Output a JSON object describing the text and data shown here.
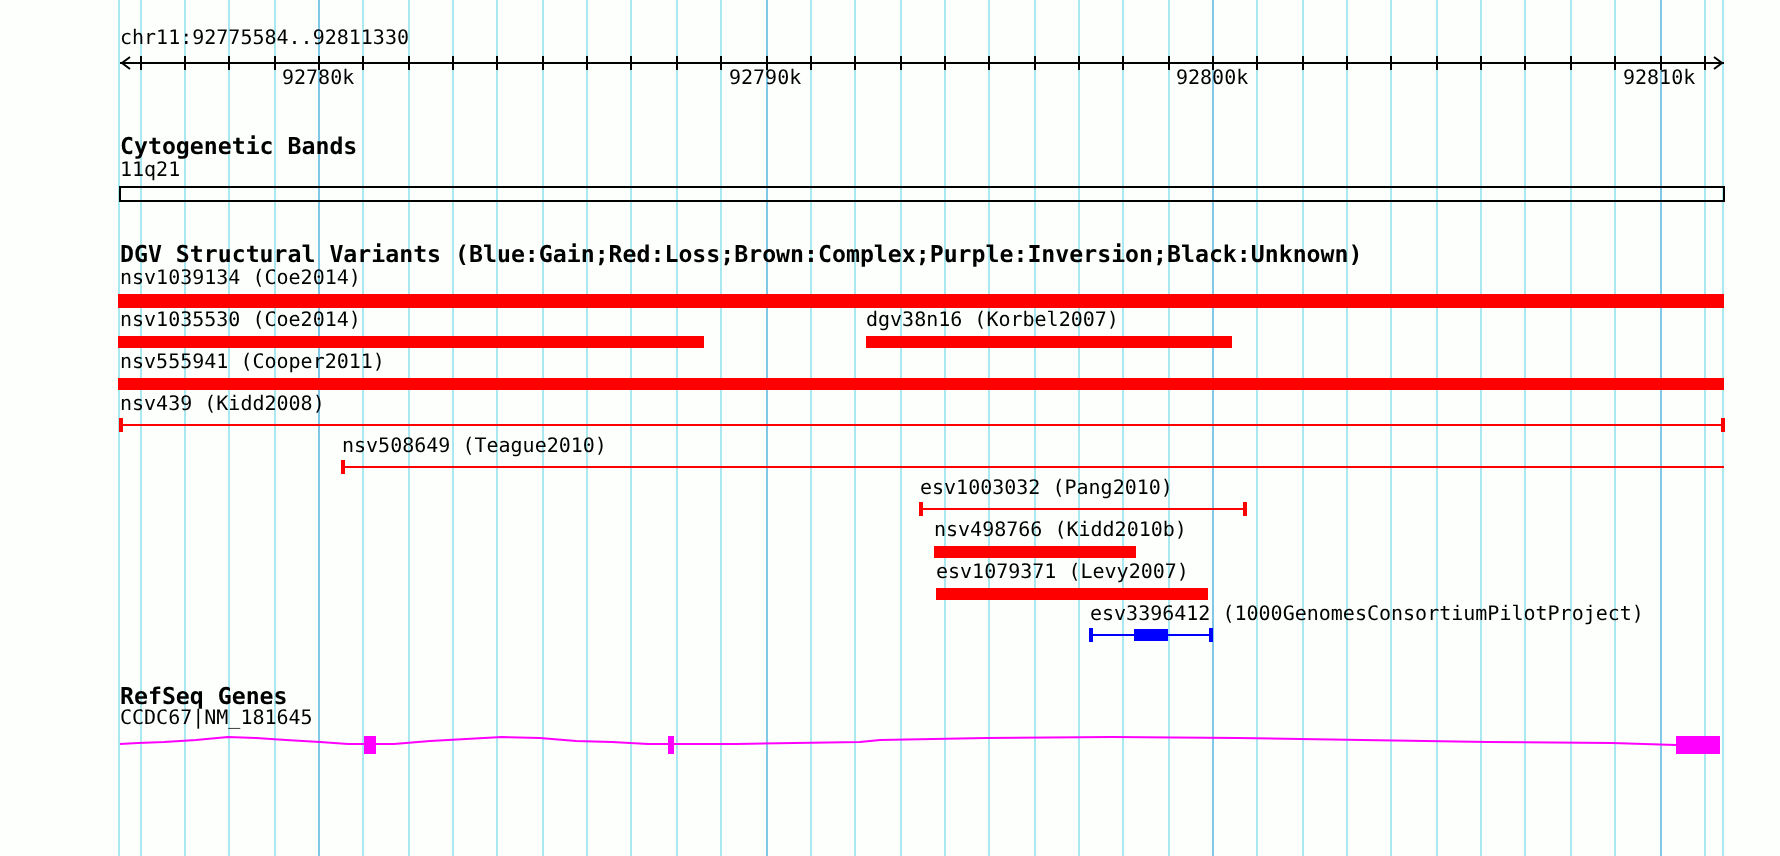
{
  "ruler": {
    "region": "chr11:92775584..92811330",
    "ticks": [
      {
        "label": "92780k"
      },
      {
        "label": "92790k"
      },
      {
        "label": "92800k"
      },
      {
        "label": "92810k"
      }
    ]
  },
  "tracks": [
    {
      "title": "Cytogenetic Bands",
      "features": [
        {
          "kind": "band",
          "label": "11q21"
        }
      ]
    },
    {
      "title": "DGV Structural Variants (Blue:Gain;Red:Loss;Brown:Complex;Purple:Inversion;Black:Unknown)",
      "features": [
        {
          "kind": "bar",
          "label": "nsv1039134 (Coe2014)",
          "color": "#ff0000"
        },
        {
          "kind": "bar",
          "label": "nsv1035530 (Coe2014)",
          "color": "#ff0000"
        },
        {
          "kind": "bar",
          "label": "dgv38n16 (Korbel2007)",
          "color": "#ff0000"
        },
        {
          "kind": "bar",
          "label": "nsv555941 (Cooper2011)",
          "color": "#ff0000"
        },
        {
          "kind": "span",
          "label": "nsv439 (Kidd2008)",
          "color": "#ff0000"
        },
        {
          "kind": "span",
          "label": "nsv508649 (Teague2010)",
          "color": "#ff0000"
        },
        {
          "kind": "span",
          "label": "esv1003032 (Pang2010)",
          "color": "#ff0000"
        },
        {
          "kind": "bar",
          "label": "nsv498766 (Kidd2010b)",
          "color": "#ff0000"
        },
        {
          "kind": "bar",
          "label": "esv1079371 (Levy2007)",
          "color": "#ff0000"
        },
        {
          "kind": "span-core",
          "label": "esv3396412 (1000GenomesConsortiumPilotProject)",
          "color": "#0000ff"
        }
      ]
    },
    {
      "title": "RefSeq Genes",
      "features": [
        {
          "kind": "gene",
          "label": "CCDC67|NM_181645"
        }
      ]
    }
  ]
}
